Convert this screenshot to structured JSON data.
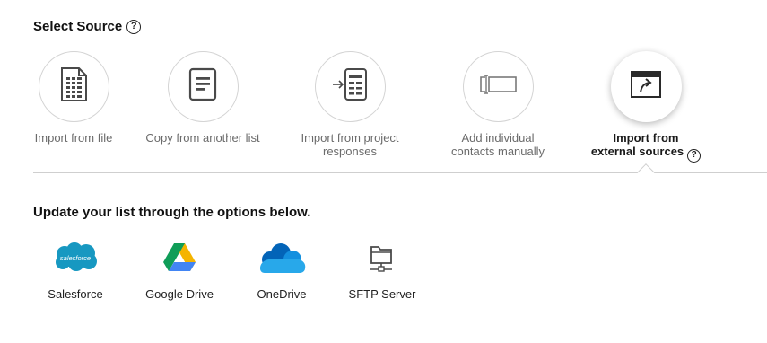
{
  "header": {
    "title": "Select Source"
  },
  "sources": [
    {
      "label": "Import from file",
      "icon": "spreadsheet-file-icon",
      "active": false
    },
    {
      "label": "Copy from another list",
      "icon": "list-document-icon",
      "active": false
    },
    {
      "label_line1": "Import from project",
      "label_line2": "responses",
      "icon": "import-responses-icon",
      "active": false
    },
    {
      "label_line1": "Add individual",
      "label_line2": "contacts manually",
      "icon": "text-input-icon",
      "active": false
    },
    {
      "label_line1": "Import from",
      "label_line2": "external sources",
      "icon": "external-window-icon",
      "active": true
    }
  ],
  "external": {
    "title": "Update your list through the options below.",
    "options": [
      {
        "label": "Salesforce",
        "logo_text": "salesforce",
        "icon": "salesforce-logo"
      },
      {
        "label": "Google Drive",
        "icon": "google-drive-logo"
      },
      {
        "label": "OneDrive",
        "icon": "onedrive-logo"
      },
      {
        "label": "SFTP Server",
        "icon": "sftp-server-icon"
      }
    ]
  },
  "colors": {
    "salesforce": "#1798c1",
    "gdrive_green": "#0f9d58",
    "gdrive_yellow": "#f4b400",
    "gdrive_blue": "#4285f4",
    "onedrive_dark": "#0364b8",
    "onedrive_light": "#28a8ea"
  }
}
